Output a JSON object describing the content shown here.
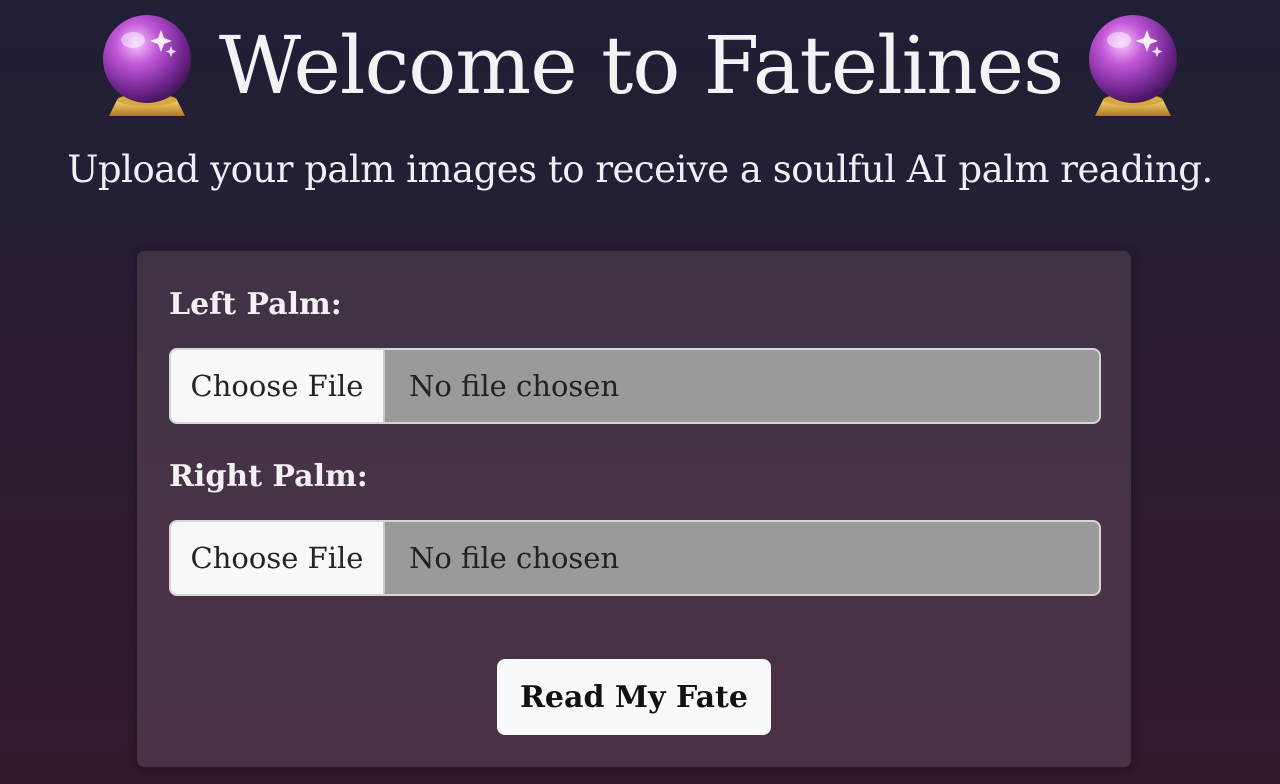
{
  "header": {
    "title": "Welcome to Fatelines",
    "subtitle": "Upload your palm images to receive a soulful AI palm reading.",
    "decoration_icon": "crystal-ball-icon"
  },
  "form": {
    "left_palm": {
      "label": "Left Palm:",
      "button_label": "Choose File",
      "status": "No file chosen"
    },
    "right_palm": {
      "label": "Right Palm:",
      "button_label": "Choose File",
      "status": "No file chosen"
    },
    "submit_label": "Read My Fate"
  },
  "colors": {
    "background_top": "#1f1f35",
    "background_bottom": "#34192b",
    "card": "#473345",
    "file_field": "#9a9a9a",
    "button": "#f8f9fa"
  }
}
